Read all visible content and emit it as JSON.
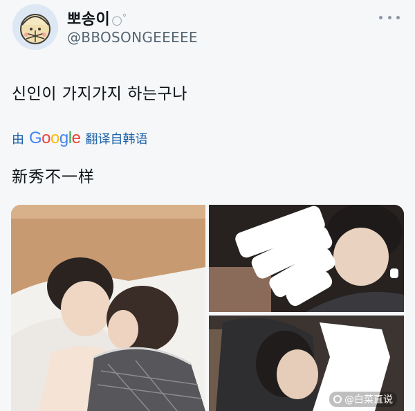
{
  "user": {
    "display_name": "뽀송이",
    "name_decoration": "○゜",
    "handle": "@BBOSONGEEEEE"
  },
  "tweet": {
    "text": "신인이 가지가지 하는구나",
    "translation_prefix": "由",
    "translation_logo": "Google",
    "translation_suffix": "翻译自韩语",
    "translated_text": "新秀不一样"
  },
  "media": {
    "watermark": "@白菜直说"
  },
  "colors": {
    "accent": "#1d62a8",
    "handle": "#536471"
  },
  "icons": [
    "more-options-icon",
    "watermark-icon"
  ]
}
